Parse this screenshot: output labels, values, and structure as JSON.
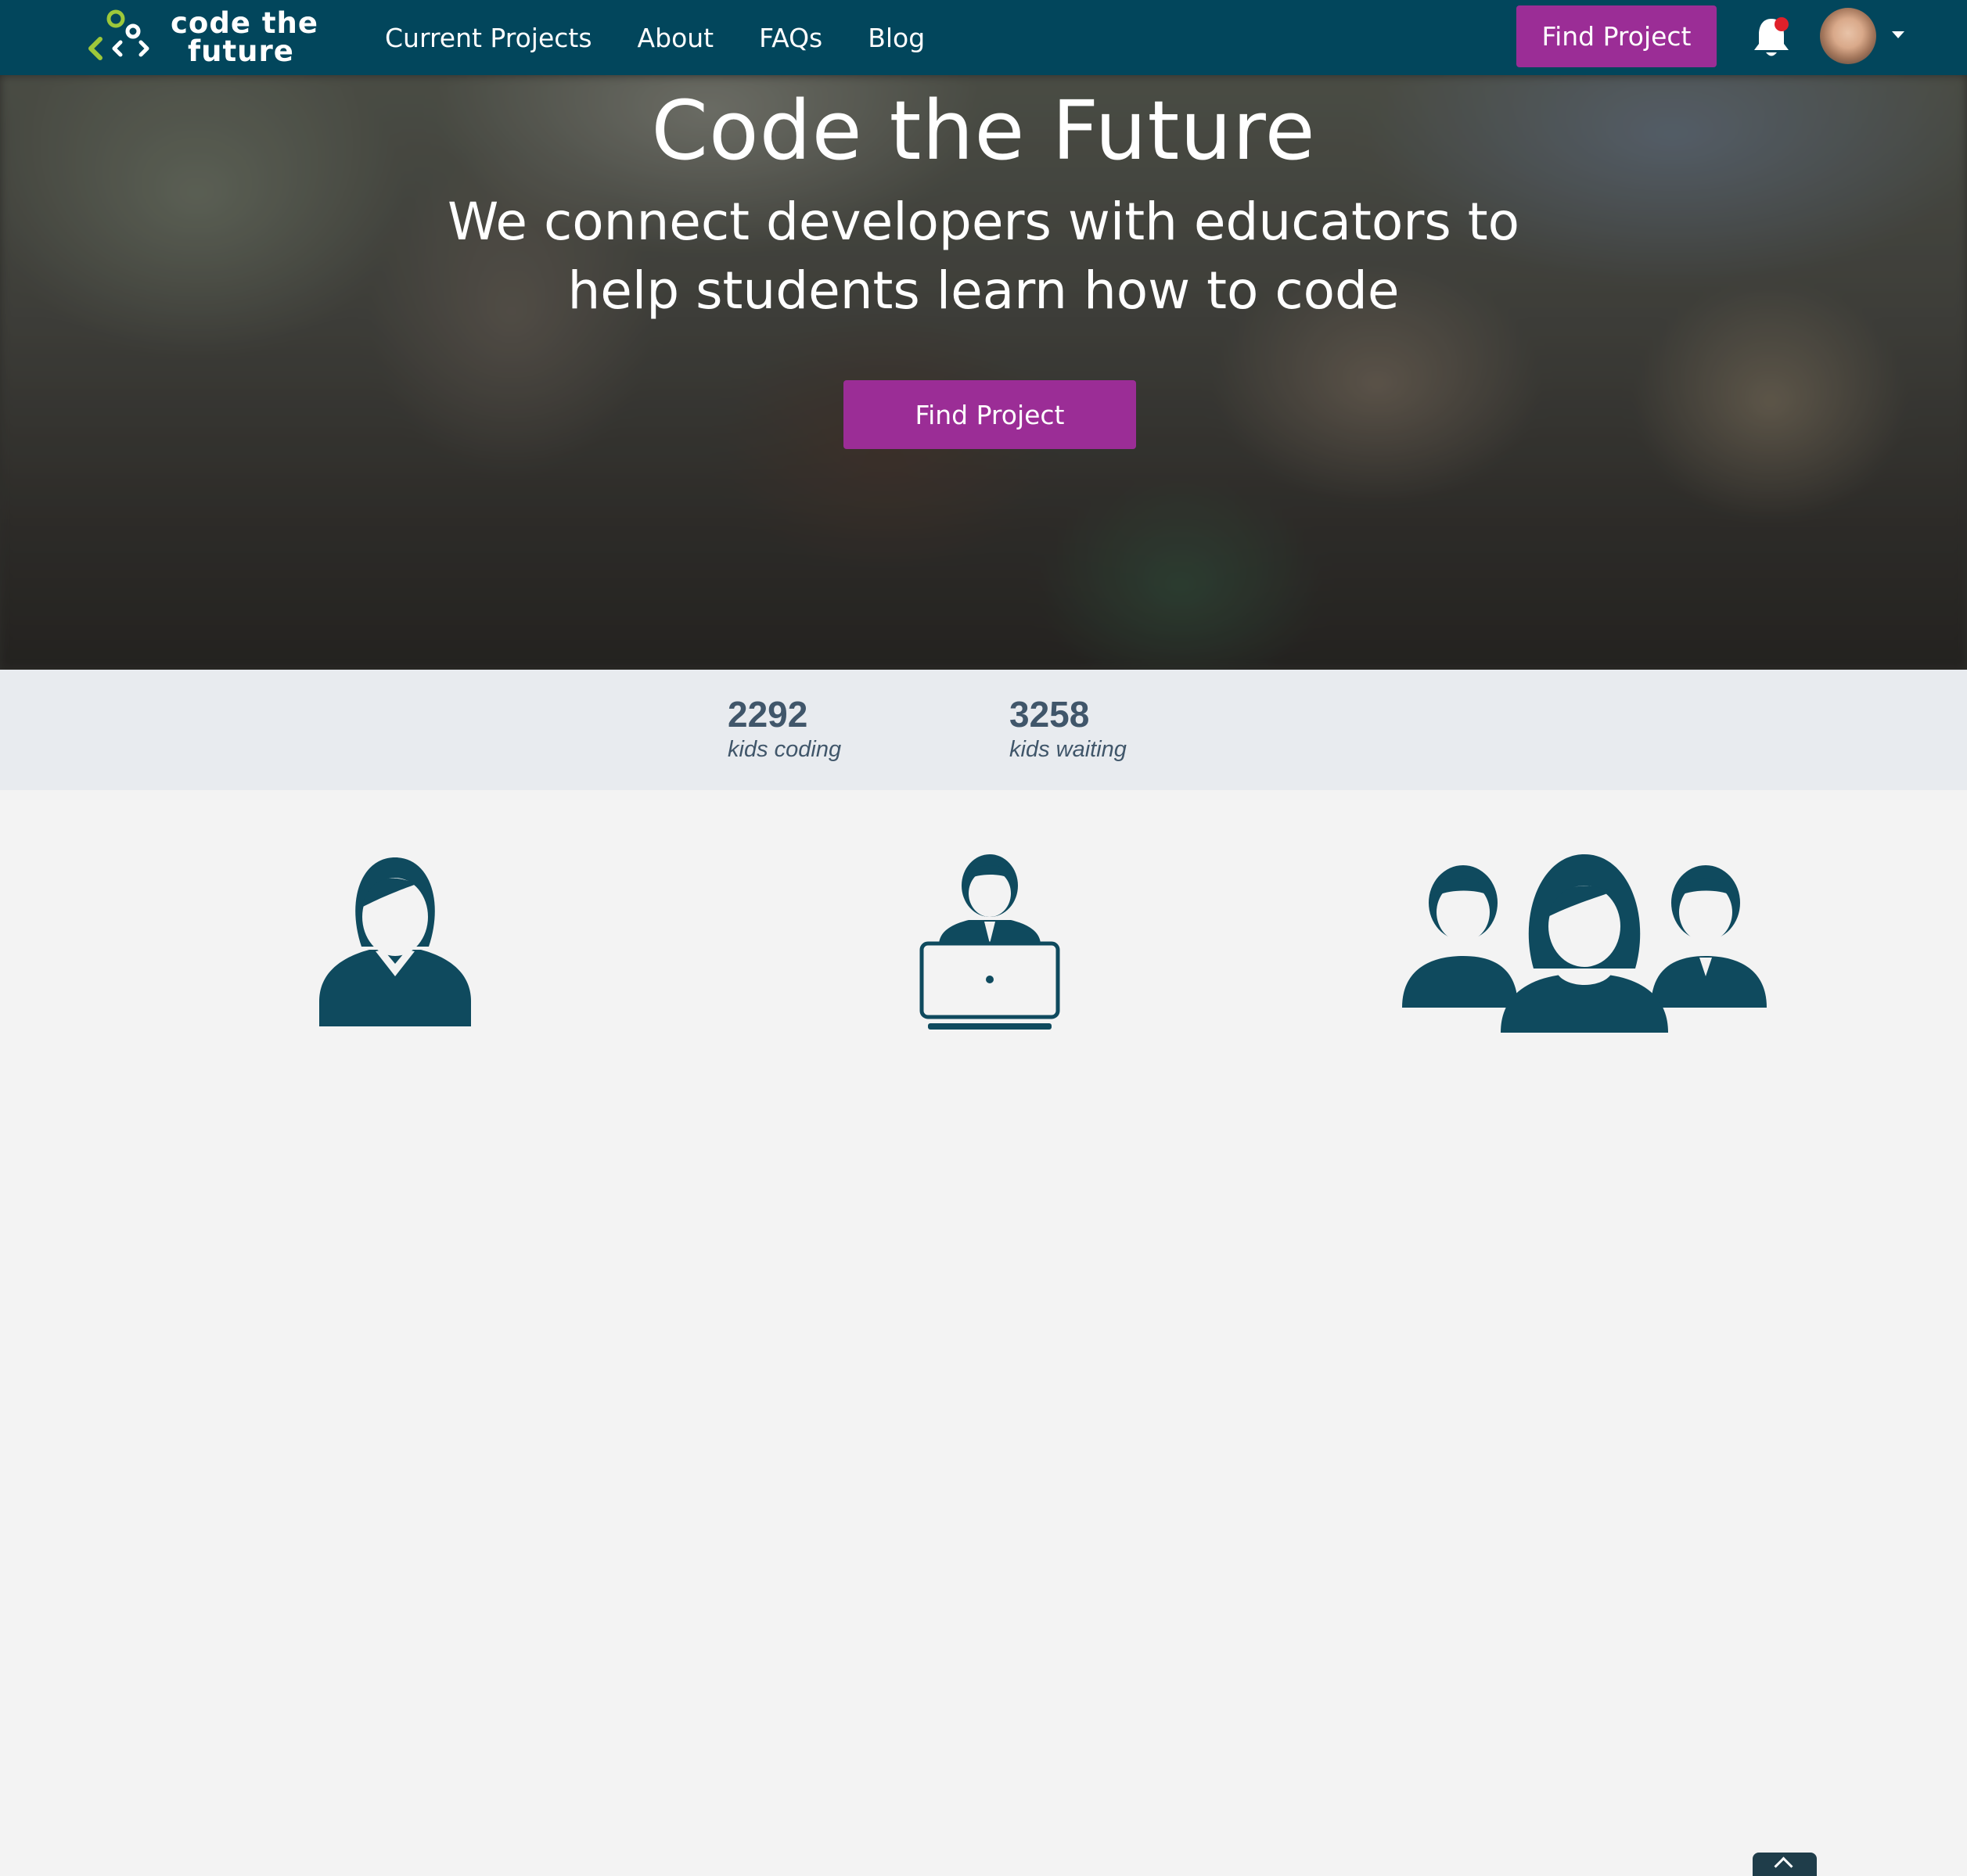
{
  "brand": {
    "line1": "code the",
    "line2": "future",
    "accent_color": "#9dc83a"
  },
  "nav": {
    "links": [
      "Current Projects",
      "About",
      "FAQs",
      "Blog"
    ],
    "find_button": "Find Project",
    "notification_icon": "bell-icon",
    "has_unread_notification": true
  },
  "hero": {
    "title": "Code the Future",
    "subtitle": "We connect developers with educators to help students learn how to code",
    "cta": "Find Project"
  },
  "stats": [
    {
      "number": "2292",
      "label": "kids coding"
    },
    {
      "number": "3258",
      "label": "kids waiting"
    }
  ],
  "features": {
    "icons": [
      "educator-icon",
      "developer-laptop-icon",
      "students-group-icon"
    ]
  },
  "colors": {
    "navbar": "#02465c",
    "button": "#9b2d96",
    "icon": "#0f4a5e",
    "stats_bg": "#e8ebef"
  }
}
